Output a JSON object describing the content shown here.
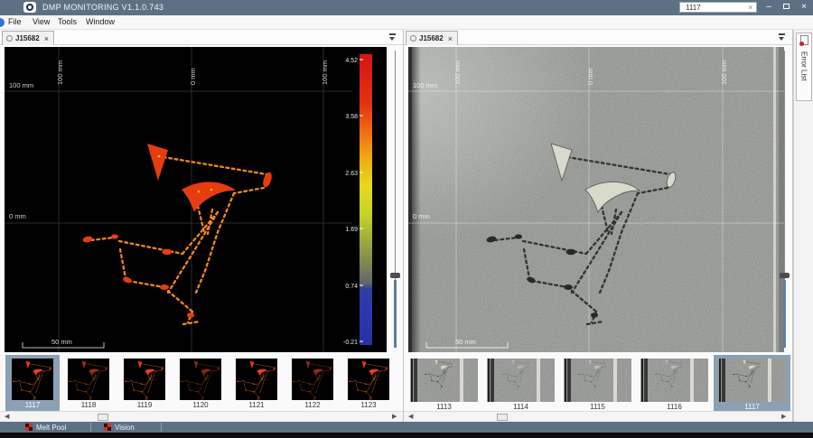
{
  "window": {
    "title": "DMP MONITORING V1.1.0.743",
    "search_value": "1117",
    "buttons": {
      "clear": "×",
      "minimize": "–",
      "close": "×"
    }
  },
  "menu": {
    "items": [
      "File",
      "View",
      "Tools",
      "Window"
    ]
  },
  "left_panel": {
    "tab": {
      "label": "J15682",
      "close": "×"
    },
    "plot": {
      "x_labels": [
        "100 mm",
        "0 mm",
        "100 mm"
      ],
      "y_labels": [
        "100 mm",
        "0 mm"
      ],
      "scale_label": "50 mm",
      "colorbar": {
        "ticks": [
          "4.52",
          "3.58",
          "2.63",
          "1.69",
          "0.74",
          "-0.21"
        ],
        "top_color": "#d61515",
        "bottom_color": "#2832a6"
      }
    },
    "thumbnails": [
      {
        "label": "1117",
        "selected": true
      },
      {
        "label": "1118",
        "selected": false
      },
      {
        "label": "1119",
        "selected": false
      },
      {
        "label": "1120",
        "selected": false
      },
      {
        "label": "1121",
        "selected": false
      },
      {
        "label": "1122",
        "selected": false
      },
      {
        "label": "1123",
        "selected": false
      }
    ]
  },
  "right_panel": {
    "tab": {
      "label": "J15682",
      "close": "×"
    },
    "plot": {
      "x_labels": [
        "100 mm",
        "0 mm",
        "100 mm"
      ],
      "y_labels": [
        "100 mm",
        "0 mm"
      ],
      "scale_label": "50 mm"
    },
    "thumbnails": [
      {
        "label": "1113",
        "selected": false
      },
      {
        "label": "1114",
        "selected": false
      },
      {
        "label": "1115",
        "selected": false
      },
      {
        "label": "1116",
        "selected": false
      },
      {
        "label": "1117",
        "selected": true
      }
    ]
  },
  "error_list": {
    "label": "Error List"
  },
  "status_bar": {
    "tabs": [
      {
        "label": "Melt Pool"
      },
      {
        "label": "Vision"
      }
    ]
  },
  "icons": {
    "scroll_left": "◀",
    "scroll_right": "▶"
  },
  "colors": {
    "titlebar": "#5d7185",
    "selection": "#8ba0b5",
    "meltpool_orange": "#f5871e",
    "meltpool_red": "#e73c0f"
  }
}
